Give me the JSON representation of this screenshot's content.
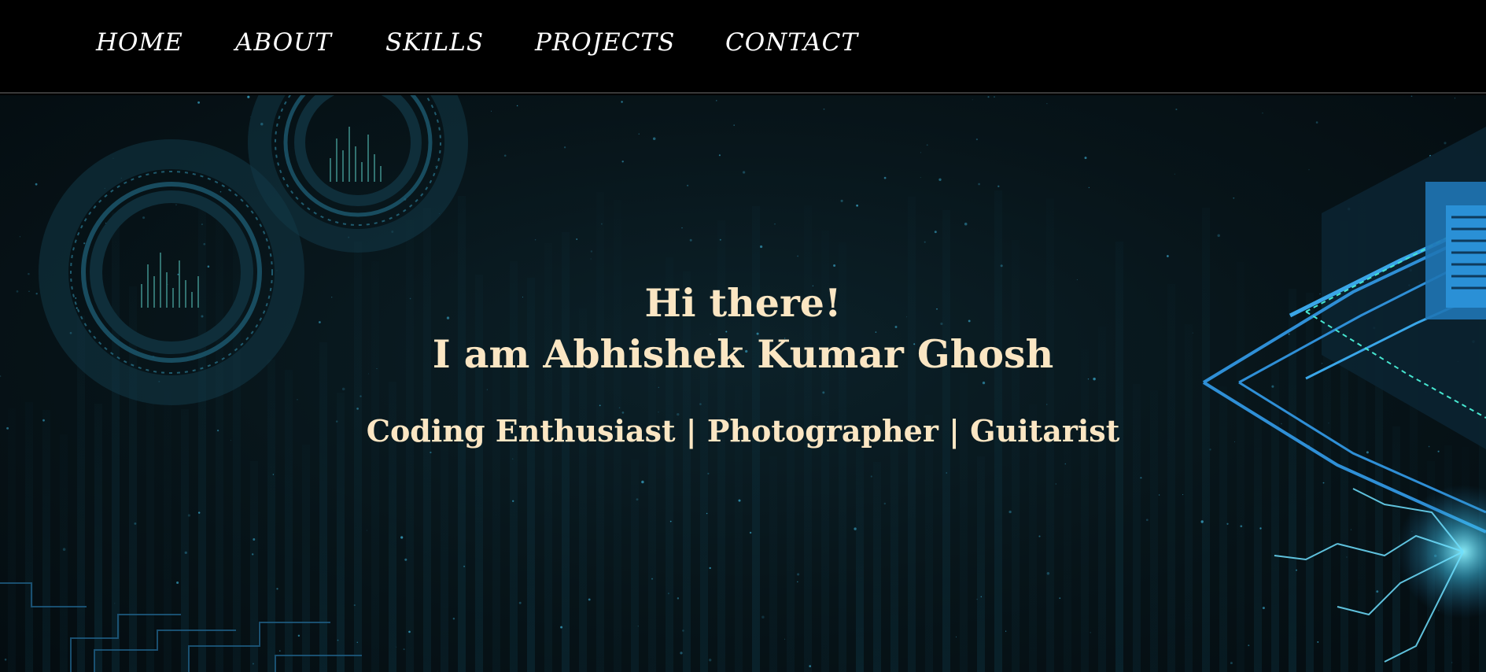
{
  "nav": {
    "items": [
      {
        "label": "HOME"
      },
      {
        "label": "ABOUT"
      },
      {
        "label": "SKILLS"
      },
      {
        "label": "PROJECTS"
      },
      {
        "label": "CONTACT"
      }
    ]
  },
  "hero": {
    "greeting": "Hi there!",
    "name": "I am Abhishek Kumar Ghosh",
    "tagline": "Coding Enthusiast | Photographer | Guitarist"
  },
  "colors": {
    "nav_bg": "#000000",
    "nav_text": "#ffffff",
    "hero_text": "#fbe6c3",
    "hero_bg": "#071419",
    "accent": "#2f8fd6"
  }
}
